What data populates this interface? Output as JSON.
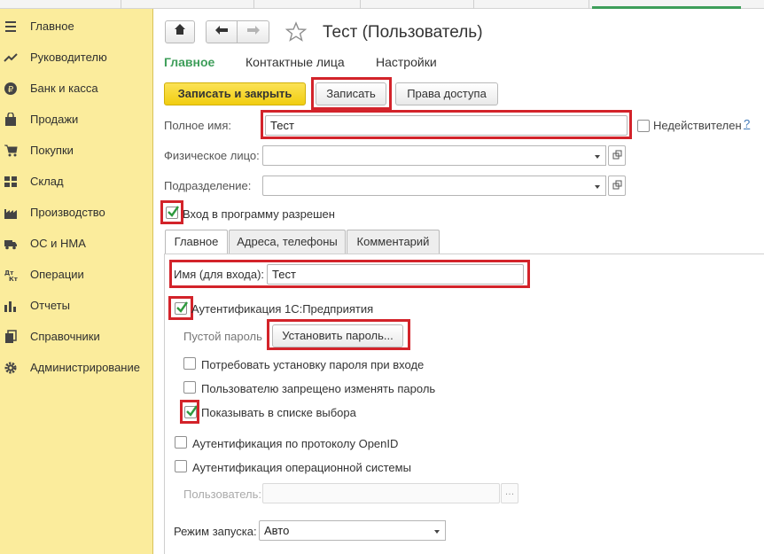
{
  "sidebar": {
    "items": [
      {
        "label": "Главное",
        "icon": "menu-lines-icon"
      },
      {
        "label": "Руководителю",
        "icon": "trend-icon"
      },
      {
        "label": "Банк и касса",
        "icon": "ruble-coin-icon"
      },
      {
        "label": "Продажи",
        "icon": "shopping-bag-icon"
      },
      {
        "label": "Покупки",
        "icon": "cart-icon"
      },
      {
        "label": "Склад",
        "icon": "warehouse-grid-icon"
      },
      {
        "label": "Производство",
        "icon": "factory-icon"
      },
      {
        "label": "ОС и НМА",
        "icon": "truck-icon"
      },
      {
        "label": "Операции",
        "icon": "dt-kt-icon"
      },
      {
        "label": "Отчеты",
        "icon": "bar-chart-icon"
      },
      {
        "label": "Справочники",
        "icon": "books-icon"
      },
      {
        "label": "Администрирование",
        "icon": "gear-icon"
      }
    ]
  },
  "header": {
    "title": "Тест (Пользователь)"
  },
  "nav_tabs": [
    {
      "label": "Главное",
      "active": true
    },
    {
      "label": "Контактные лица",
      "active": false
    },
    {
      "label": "Настройки",
      "active": false
    }
  ],
  "toolbar": {
    "save_close": "Записать и закрыть",
    "save": "Записать",
    "access_rights": "Права доступа"
  },
  "form": {
    "full_name_label": "Полное имя:",
    "full_name_value": "Тест",
    "invalid_label": "Недействителен",
    "invalid_checked": false,
    "help": "?",
    "individual_label": "Физическое лицо:",
    "individual_value": "",
    "department_label": "Подразделение:",
    "department_value": "",
    "login_allowed_label": "Вход в программу разрешен",
    "login_allowed_checked": true
  },
  "inner_tabs": [
    {
      "label": "Главное",
      "active": true
    },
    {
      "label": "Адреса, телефоны",
      "active": false
    },
    {
      "label": "Комментарий",
      "active": false
    }
  ],
  "auth": {
    "login_name_label": "Имя (для входа):",
    "login_name_value": "Тест",
    "auth_1c_label": "Аутентификация 1С:Предприятия",
    "auth_1c_checked": true,
    "empty_password_label": "Пустой пароль",
    "set_password_button": "Установить пароль...",
    "require_password_change_label": "Потребовать установку пароля при входе",
    "require_password_change_checked": false,
    "forbid_password_change_label": "Пользователю запрещено изменять пароль",
    "forbid_password_change_checked": false,
    "show_in_list_label": "Показывать в списке выбора",
    "show_in_list_checked": true,
    "openid_label": "Аутентификация по протоколу OpenID",
    "openid_checked": false,
    "os_auth_label": "Аутентификация операционной системы",
    "os_auth_checked": false,
    "os_user_label": "Пользователь:",
    "os_user_value": "",
    "launch_mode_label": "Режим запуска:",
    "launch_mode_value": "Авто"
  },
  "colors": {
    "sidebar_bg": "#fbec9c",
    "accent_green": "#3e9e5a",
    "primary_button": "#f5d415",
    "highlight_red": "#d3232a"
  }
}
